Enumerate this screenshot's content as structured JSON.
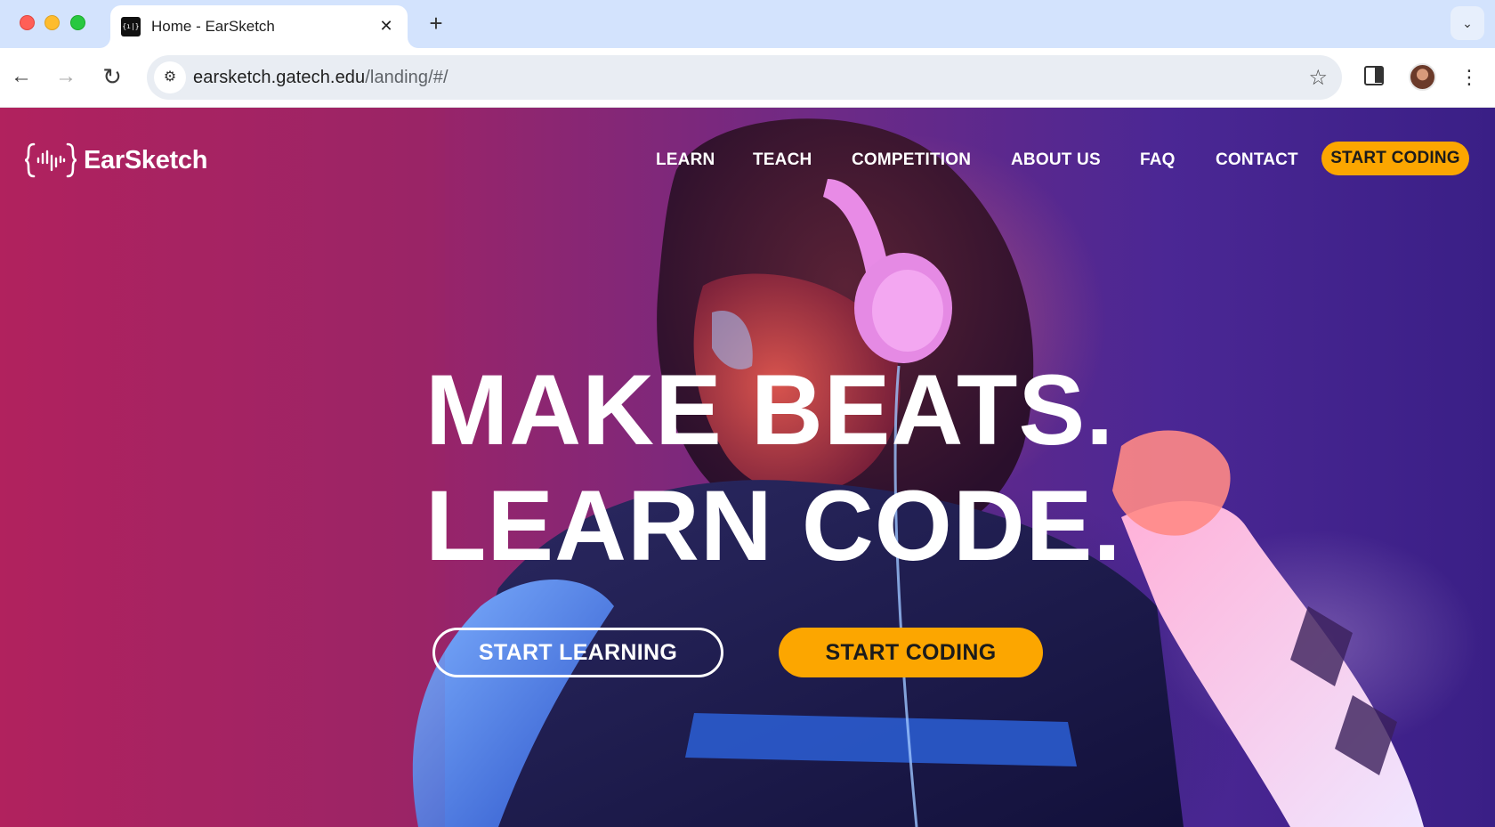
{
  "browser": {
    "tab": {
      "title": "Home - EarSketch",
      "favicon": "earsketch-favicon"
    },
    "address": {
      "domain": "earsketch.gatech.edu",
      "path": "/landing/#/"
    },
    "icons": {
      "close": "✕",
      "new_tab": "+",
      "tab_search": "⌄",
      "back": "←",
      "forward": "→",
      "reload": "↻",
      "site_info": "⚙",
      "star": "☆",
      "menu": "⋮"
    },
    "colors": {
      "tabbar": "#d3e3fd",
      "omnibox": "#e9edf3"
    }
  },
  "site": {
    "brand": {
      "name": "EarSketch"
    },
    "nav": {
      "learn": "LEARN",
      "teach": "TEACH",
      "competition": "COMPETITION",
      "about": "ABOUT US",
      "faq": "FAQ",
      "contact": "CONTACT",
      "cta": "START CODING"
    },
    "hero": {
      "line1": "MAKE BEATS.",
      "line2": "LEARN CODE.",
      "primary_button": "START LEARNING",
      "secondary_button": "START CODING"
    },
    "colors": {
      "accent": "#fca600",
      "hero_left": "#b2225f",
      "hero_right": "#3a1f86"
    }
  }
}
